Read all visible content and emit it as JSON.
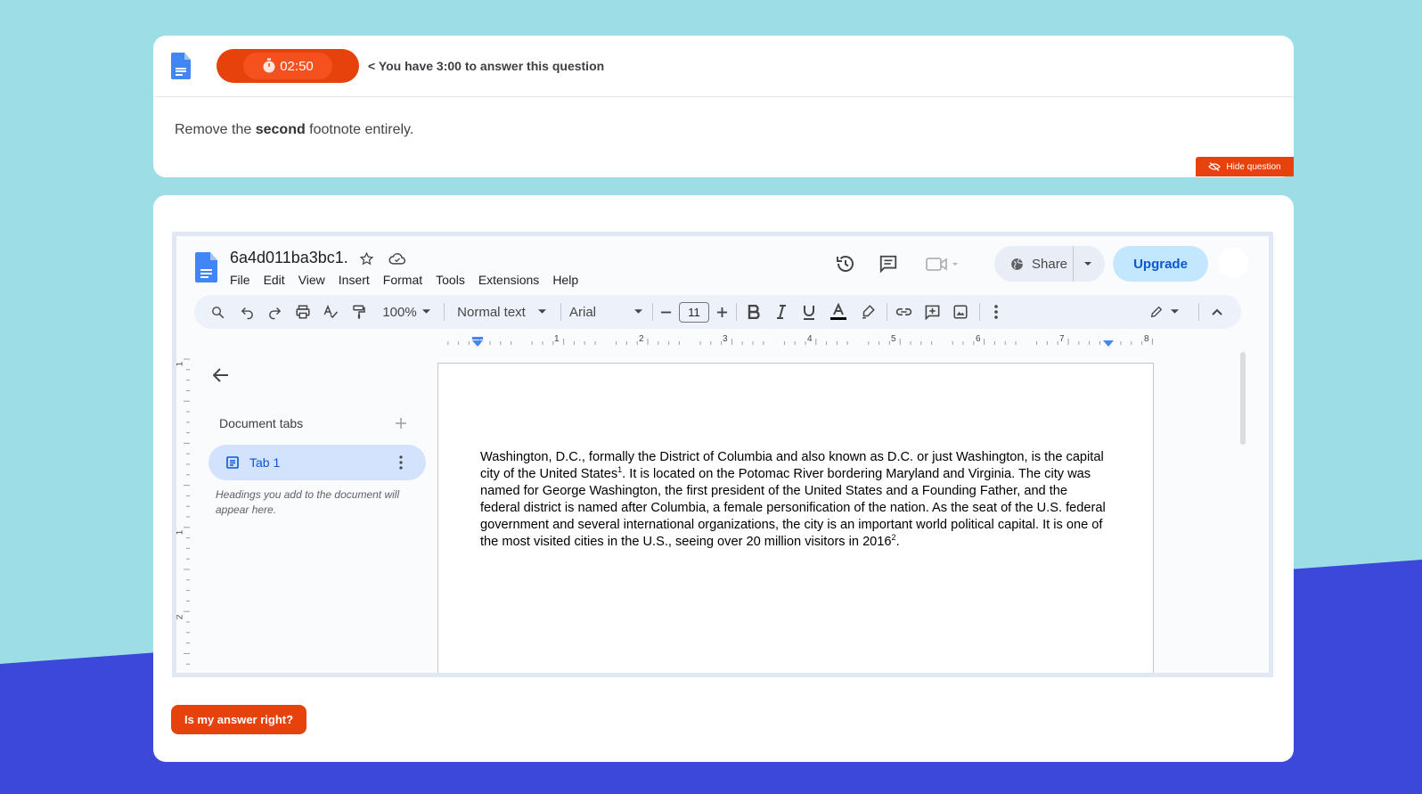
{
  "colors": {
    "accent": "#e8420c",
    "bg_top": "#9cdde6",
    "bg_bottom": "#3b48d9",
    "docs_blue": "#4285f4"
  },
  "quiz": {
    "timer": "02:50",
    "timer_message": "< You have 3:00 to answer this question",
    "instruction_pre": "Remove the ",
    "instruction_bold": "second",
    "instruction_post": " footnote entirely.",
    "hide_label": "Hide question",
    "check_label": "Is my answer right?"
  },
  "docs": {
    "title": "6a4d011ba3bc1.",
    "menu": [
      "File",
      "Edit",
      "View",
      "Insert",
      "Format",
      "Tools",
      "Extensions",
      "Help"
    ],
    "share_label": "Share",
    "upgrade_label": "Upgrade",
    "toolbar": {
      "zoom": "100%",
      "style": "Normal text",
      "font": "Arial",
      "font_size": "11"
    },
    "ruler_numbers": [
      "1",
      "2",
      "3",
      "4",
      "5",
      "6",
      "7",
      "8"
    ],
    "vruler_numbers": [
      "1",
      "1",
      "2"
    ],
    "sidebar": {
      "title": "Document tabs",
      "tab_label": "Tab 1",
      "hint": "Headings you add to the document will appear here."
    },
    "body": {
      "seg1": "Washington, D.C., formally the District of Columbia and also known as D.C. or just Washington, is the capital city of the United States",
      "fn1": "1",
      "seg2": ". It is located on the Potomac River bordering Maryland and Virginia. The city was named for George Washington, the first president of the United States and a Founding Father, and the federal district is named after Columbia, a female personification of the nation. As the seat of the U.S. federal government and several international organizations, the city is an important world political capital. It is one of the most visited cities in the U.S., seeing over 20 million visitors in 2016",
      "fn2": "2",
      "seg3": "."
    }
  }
}
